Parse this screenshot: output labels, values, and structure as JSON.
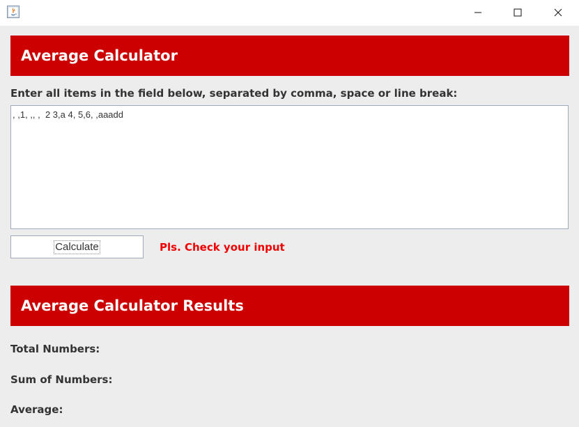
{
  "window": {
    "icon": "java-icon",
    "minimize_icon": "minimize-icon",
    "maximize_icon": "maximize-icon",
    "close_icon": "close-icon"
  },
  "main": {
    "title": "Average Calculator",
    "instructions": "Enter all items in the field below, separated by comma, space or line break:",
    "input_value": ", ,1, ,, ,  2 3,a 4, 5,6, ,aaadd",
    "calculate_label": "Calculate",
    "error_message": "Pls. Check your input"
  },
  "results": {
    "title": "Average Calculator Results",
    "total_label": "Total Numbers:",
    "sum_label": "Sum of Numbers:",
    "average_label": "Average:"
  },
  "colors": {
    "header_bg": "#cc0000",
    "error_text": "#ee0000",
    "window_bg": "#ededed"
  }
}
